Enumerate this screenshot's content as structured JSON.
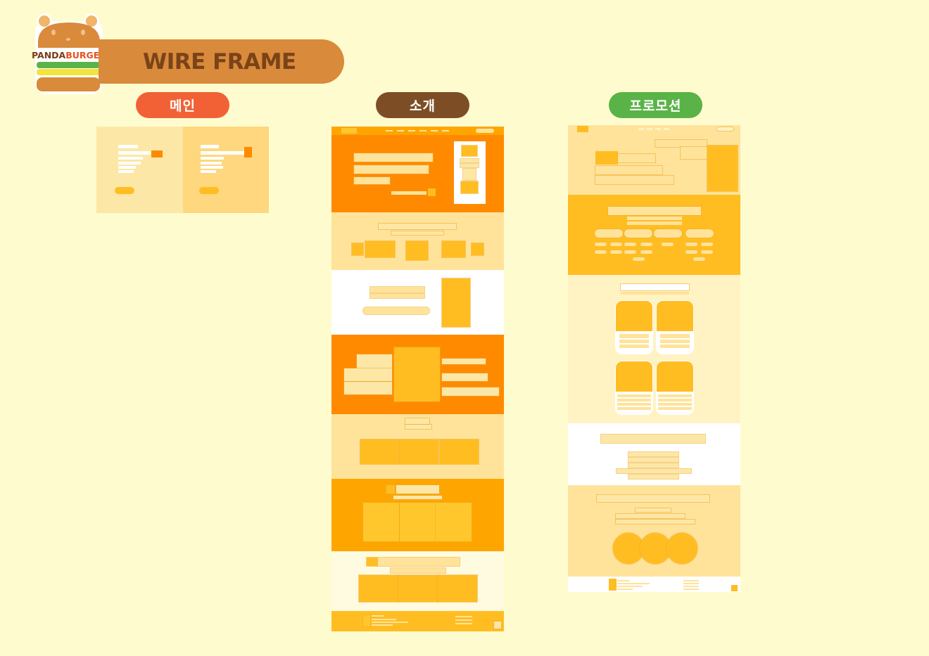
{
  "logo": {
    "word_left": "PANDA",
    "word_right": "BURGER",
    "colors": {
      "bun": "#d98a3b",
      "ear": "#f0b46a",
      "lettuce": "#5cb34a",
      "cheese": "#f4e33a",
      "text_left": "#7a3b16",
      "text_right": "#e8521f"
    }
  },
  "header": {
    "title": "WIRE FRAME",
    "title_color": "#7a4318",
    "banner_color": "#d98a3b"
  },
  "columns": [
    {
      "label": "메인",
      "color": "#f26135"
    },
    {
      "label": "소개",
      "color": "#7d4e26"
    },
    {
      "label": "프로모션",
      "color": "#5ab346"
    }
  ],
  "palette": {
    "background": "#fefccf",
    "deep_orange": "#ff8a00",
    "orange": "#ffa500",
    "gold": "#ffbd22",
    "pale": "#ffe39a",
    "cream": "#fff3c4"
  }
}
